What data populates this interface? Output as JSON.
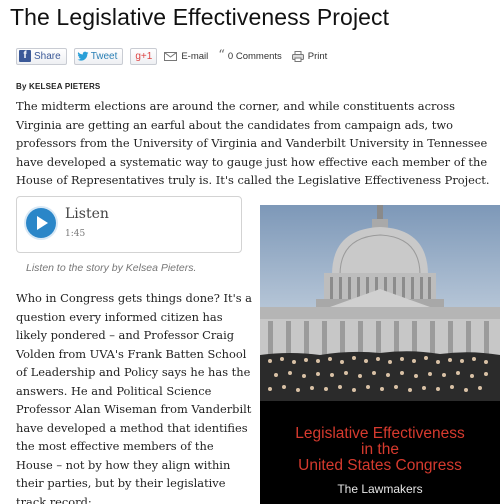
{
  "article": {
    "title": "The Legislative Effectiveness Project",
    "byline": "By KELSEA PIETERS",
    "lead": "The midterm elections are around the corner, and while constituents across Virginia are getting an earful about the candidates from campaign ads, two professors from the University of Virginia and Vanderbilt University in Tennessee have developed a systematic way to gauge just how effective each member of the House of Representatives truly is. It's called the Legislative Effectiveness Project.",
    "body": "Who in Congress gets things done? It's a question every informed citizen has likely pondered – and Professor Craig Volden from UVA's Frank Batten School of Leadership and Policy says he has the answers. He and Political Science Professor Alan Wiseman from Vanderbilt have developed a method that identifies the most effective members of the House – not by how they align within their parties, but by their legislative track record:"
  },
  "share": {
    "facebook": "Share",
    "twitter": "Tweet",
    "googleplus": "g+1",
    "email": "E-mail",
    "comments": "0 Comments",
    "print": "Print"
  },
  "audio": {
    "label": "Listen",
    "duration": "1:45",
    "caption": "Listen to the story by Kelsea Pieters."
  },
  "book": {
    "title_line1": "Legislative Effectiveness",
    "title_line2": "in the",
    "title_line3": "United States Congress",
    "subtitle": "The Lawmakers",
    "title_color": "#d63a2e"
  },
  "colors": {
    "play_button": "#2a86c8",
    "facebook": "#3b5998",
    "twitter": "#2a7fb5"
  }
}
